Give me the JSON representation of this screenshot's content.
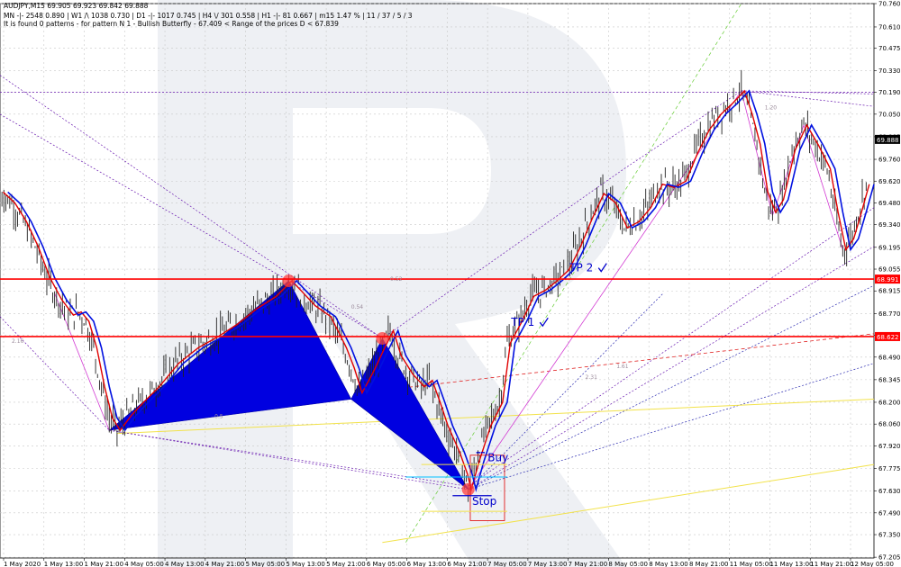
{
  "header": {
    "symbol_line": "AUDJPY,M15  69.905 69.923 69.842 69.888",
    "timeframes_line": "MN -|- 2548  0.890  |  W1 /\\ 1038  0.730  |  D1 -|- 1017  0.745  |  H4 \\/ 301  0.558  |  H1 -|- 81  0.667  |  m15 1.47 %  |  11 / 37 / 5 / 3",
    "pattern_line": "It is found 0 patterns  -  for pattern N 1 - Bullish Butterfly - 67.409 < Range of the prices D < 67.839"
  },
  "chart_data": {
    "type": "line",
    "symbol": "AUDJPY",
    "timeframe": "M15",
    "ylim": [
      67.2,
      70.76
    ],
    "y_ticks": [
      "70.760",
      "70.610",
      "70.475",
      "70.330",
      "70.190",
      "70.050",
      "69.905",
      "69.760",
      "69.620",
      "69.480",
      "69.340",
      "69.195",
      "69.055",
      "68.915",
      "68.770",
      "68.630",
      "68.490",
      "68.345",
      "68.200",
      "68.060",
      "67.920",
      "67.775",
      "67.630",
      "67.490",
      "67.350",
      "67.205"
    ],
    "x_ticks": [
      "1 May 2020",
      "1 May 13:00",
      "1 May 21:00",
      "4 May 05:00",
      "4 May 13:00",
      "4 May 21:00",
      "5 May 05:00",
      "5 May 13:00",
      "5 May 21:00",
      "6 May 05:00",
      "6 May 13:00",
      "6 May 21:00",
      "7 May 05:00",
      "7 May 13:00",
      "7 May 21:00",
      "8 May 05:00",
      "8 May 13:00",
      "8 May 21:00",
      "11 May 05:00",
      "11 May 13:00",
      "11 May 21:00",
      "12 May 05:00"
    ],
    "current_price": "69.888",
    "series": [
      {
        "values": [
          [
            0,
            69.55
          ],
          [
            3,
            69.48
          ],
          [
            6,
            69.36
          ],
          [
            9,
            69.2
          ],
          [
            12,
            69.0
          ],
          [
            15,
            68.86
          ],
          [
            18,
            68.76
          ],
          [
            20,
            68.78
          ],
          [
            22,
            68.72
          ],
          [
            24,
            68.55
          ],
          [
            26,
            68.3
          ],
          [
            28,
            68.1
          ],
          [
            30,
            68.02
          ],
          [
            33,
            68.12
          ],
          [
            36,
            68.2
          ],
          [
            40,
            68.3
          ],
          [
            45,
            68.45
          ],
          [
            50,
            68.55
          ],
          [
            55,
            68.62
          ],
          [
            60,
            68.7
          ],
          [
            65,
            68.8
          ],
          [
            70,
            68.88
          ],
          [
            74,
            68.98
          ],
          [
            77,
            68.9
          ],
          [
            80,
            68.82
          ],
          [
            84,
            68.75
          ],
          [
            88,
            68.55
          ],
          [
            90,
            68.42
          ],
          [
            92,
            68.26
          ],
          [
            95,
            68.4
          ],
          [
            98,
            68.56
          ],
          [
            100,
            68.66
          ],
          [
            102,
            68.5
          ],
          [
            105,
            68.38
          ],
          [
            108,
            68.3
          ],
          [
            110,
            68.34
          ],
          [
            112,
            68.2
          ],
          [
            114,
            68.05
          ],
          [
            117,
            67.88
          ],
          [
            119,
            67.74
          ],
          [
            120,
            67.64
          ],
          [
            122,
            67.82
          ],
          [
            125,
            68.05
          ],
          [
            128,
            68.2
          ],
          [
            130,
            68.58
          ],
          [
            133,
            68.72
          ],
          [
            136,
            68.88
          ],
          [
            139,
            68.92
          ],
          [
            142,
            68.98
          ],
          [
            145,
            69.05
          ],
          [
            148,
            69.2
          ],
          [
            151,
            69.38
          ],
          [
            154,
            69.54
          ],
          [
            157,
            69.48
          ],
          [
            160,
            69.32
          ],
          [
            163,
            69.36
          ],
          [
            166,
            69.45
          ],
          [
            169,
            69.6
          ],
          [
            172,
            69.58
          ],
          [
            175,
            69.62
          ],
          [
            178,
            69.8
          ],
          [
            181,
            69.95
          ],
          [
            184,
            70.05
          ],
          [
            187,
            70.12
          ],
          [
            190,
            70.2
          ],
          [
            192,
            70.05
          ],
          [
            194,
            69.86
          ],
          [
            196,
            69.55
          ],
          [
            198,
            69.42
          ],
          [
            200,
            69.5
          ],
          [
            203,
            69.82
          ],
          [
            206,
            69.98
          ],
          [
            209,
            69.85
          ],
          [
            212,
            69.7
          ],
          [
            214,
            69.42
          ],
          [
            216,
            69.18
          ],
          [
            218,
            69.25
          ],
          [
            220,
            69.42
          ],
          [
            222,
            69.6
          ]
        ]
      }
    ],
    "levels": [
      {
        "price": 68.991,
        "label": "68.991",
        "color": "#ff0000"
      },
      {
        "price": 68.622,
        "label": "68.622",
        "color": "#ff0000"
      }
    ],
    "pattern": {
      "name": "Bullish Butterfly",
      "points": [
        {
          "x_index": 28,
          "price": 68.02
        },
        {
          "x_index": 74,
          "price": 68.98
        },
        {
          "x_index": 90,
          "price": 68.22
        },
        {
          "x_index": 98,
          "price": 68.61
        },
        {
          "x_index": 120,
          "price": 67.64
        }
      ]
    },
    "annotations": [
      {
        "text": "TP 2",
        "x_index": 146,
        "price": 69.04,
        "color": "#0000cc"
      },
      {
        "text": "TP 1",
        "x_index": 131,
        "price": 68.69,
        "color": "#0000cc"
      },
      {
        "text": "Buy",
        "x_index": 125,
        "price": 67.82,
        "color": "#0000cc"
      },
      {
        "text": "Stop",
        "x_index": 121,
        "price": 67.54,
        "color": "#0000cc"
      }
    ],
    "fib_labels": [
      "2.16",
      "0.5",
      "0.52",
      "2.31",
      "1.61",
      "1.20",
      "0.54"
    ],
    "grid": true,
    "legend": "none"
  }
}
